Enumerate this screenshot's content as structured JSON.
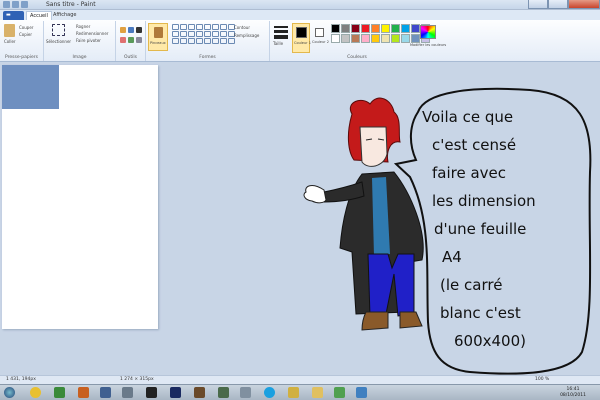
{
  "window": {
    "title": "Sans titre - Paint"
  },
  "tabs": {
    "file": "▬",
    "home": "Accueil",
    "view": "Affichage"
  },
  "ribbon": {
    "paste": "Coller",
    "cut": "Couper",
    "copy": "Copier",
    "select": "Sélectionner",
    "crop": "Rogner",
    "resize": "Redimensionner",
    "rotate": "Faire pivoter",
    "brushes": "Pinceaux",
    "outline": "Contour",
    "fill": "Remplissage",
    "size": "Taille",
    "color1": "Couleur 1",
    "color2": "Couleur 2",
    "edit_colors": "Modifier les couleurs",
    "group_clipboard": "Presse-papiers",
    "group_image": "Image",
    "group_tools": "Outils",
    "group_shapes": "Formes",
    "group_colors": "Couleurs"
  },
  "palette": [
    "#000000",
    "#7f7f7f",
    "#880015",
    "#ed1c24",
    "#ff7f27",
    "#fff200",
    "#22b14c",
    "#00a2e8",
    "#3f48cc",
    "#a349a4",
    "#ffffff",
    "#c3c3c3",
    "#b97a57",
    "#ffaec9",
    "#ffc90e",
    "#efe4b0",
    "#b5e61d",
    "#99d9ea",
    "#7092be",
    "#c8bfe7"
  ],
  "speech": {
    "lines": [
      "Voila ce que",
      "c'est censé",
      "faire avec",
      "les dimension",
      "d'une feuille",
      "A4",
      "(le carré",
      "blanc c'est",
      "600x400)"
    ]
  },
  "status": {
    "position": "1 431, 194px",
    "size": "1 274 × 315px",
    "zoom": "100 %"
  },
  "taskbar": {
    "time": "16:41",
    "date": "08/10/2011"
  }
}
